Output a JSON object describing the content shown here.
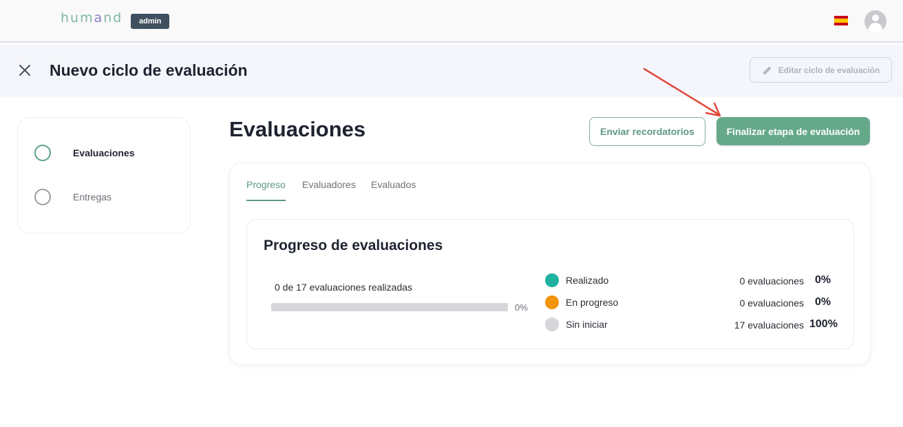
{
  "app": {
    "logo_part1": "hum",
    "logo_part2": "a",
    "logo_part3": "nd",
    "role_badge": "admin"
  },
  "header": {
    "title": "Nuevo ciclo de evaluación",
    "edit_button": "Editar ciclo de evaluación"
  },
  "steps": [
    {
      "label": "Evaluaciones",
      "active": true
    },
    {
      "label": "Entregas",
      "active": false
    }
  ],
  "main": {
    "title": "Evaluaciones",
    "reminders_button": "Enviar recordatorios",
    "finalize_button": "Finalizar etapa de evaluación",
    "tabs": [
      {
        "label": "Progreso",
        "active": true
      },
      {
        "label": "Evaluadores",
        "active": false
      },
      {
        "label": "Evaluados",
        "active": false
      }
    ],
    "progress": {
      "title": "Progreso de evaluaciones",
      "summary": "0 de 17 evaluaciones realizadas",
      "bar_value": 0,
      "bar_label": "0%",
      "legend": [
        {
          "name": "Realizado",
          "count": "0 evaluaciones",
          "pct": "0%",
          "color": "#20b2a0"
        },
        {
          "name": "En progreso",
          "count": "0 evaluaciones",
          "pct": "0%",
          "color": "#f5930a"
        },
        {
          "name": "Sin iniciar",
          "count": "17 evaluaciones",
          "pct": "100%",
          "color": "#d5d7db"
        }
      ]
    }
  },
  "colors": {
    "accent": "#66a98a",
    "annotation_arrow": "#e0483a"
  }
}
